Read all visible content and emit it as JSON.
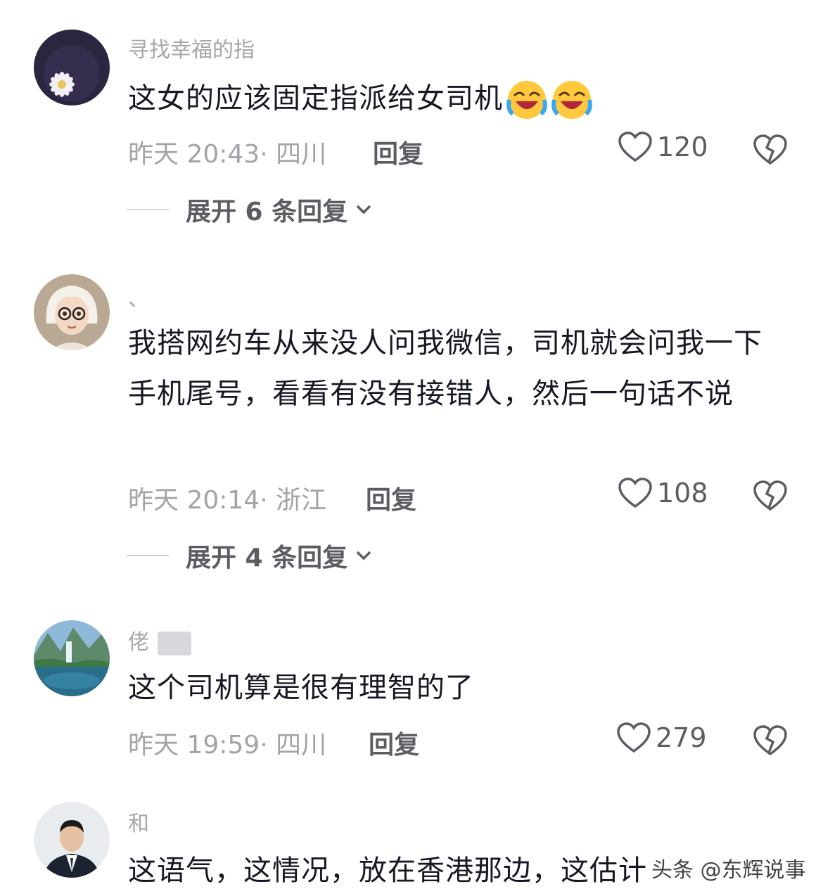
{
  "comments": [
    {
      "username": "寻找幸福的指",
      "text": "这女的应该固定指派给女司机",
      "emojis": [
        "crying-laughing-emoji",
        "crying-laughing-emoji"
      ],
      "meta": "昨天 20:43· 四川",
      "reply": "回复",
      "likes": "120",
      "expand": "展开 6 条回复"
    },
    {
      "username": "、",
      "text": "我搭网约车从来没人问我微信，司机就会问我一下手机尾号，看看有没有接错人，然后一句话不说",
      "meta": "昨天 20:14· 浙江",
      "reply": "回复",
      "likes": "108",
      "expand": "展开 4 条回复"
    },
    {
      "username": "佬",
      "text": "这个司机算是很有理智的了",
      "meta": "昨天 19:59· 四川",
      "reply": "回复",
      "likes": "279"
    },
    {
      "username": "和",
      "text": "这语气，这情况，放在香港那边，这估计"
    }
  ],
  "watermark": "头条 @东辉说事",
  "colors": {
    "text": "#161823",
    "meta": "#a3a3a8",
    "action": "#5c5c63"
  }
}
